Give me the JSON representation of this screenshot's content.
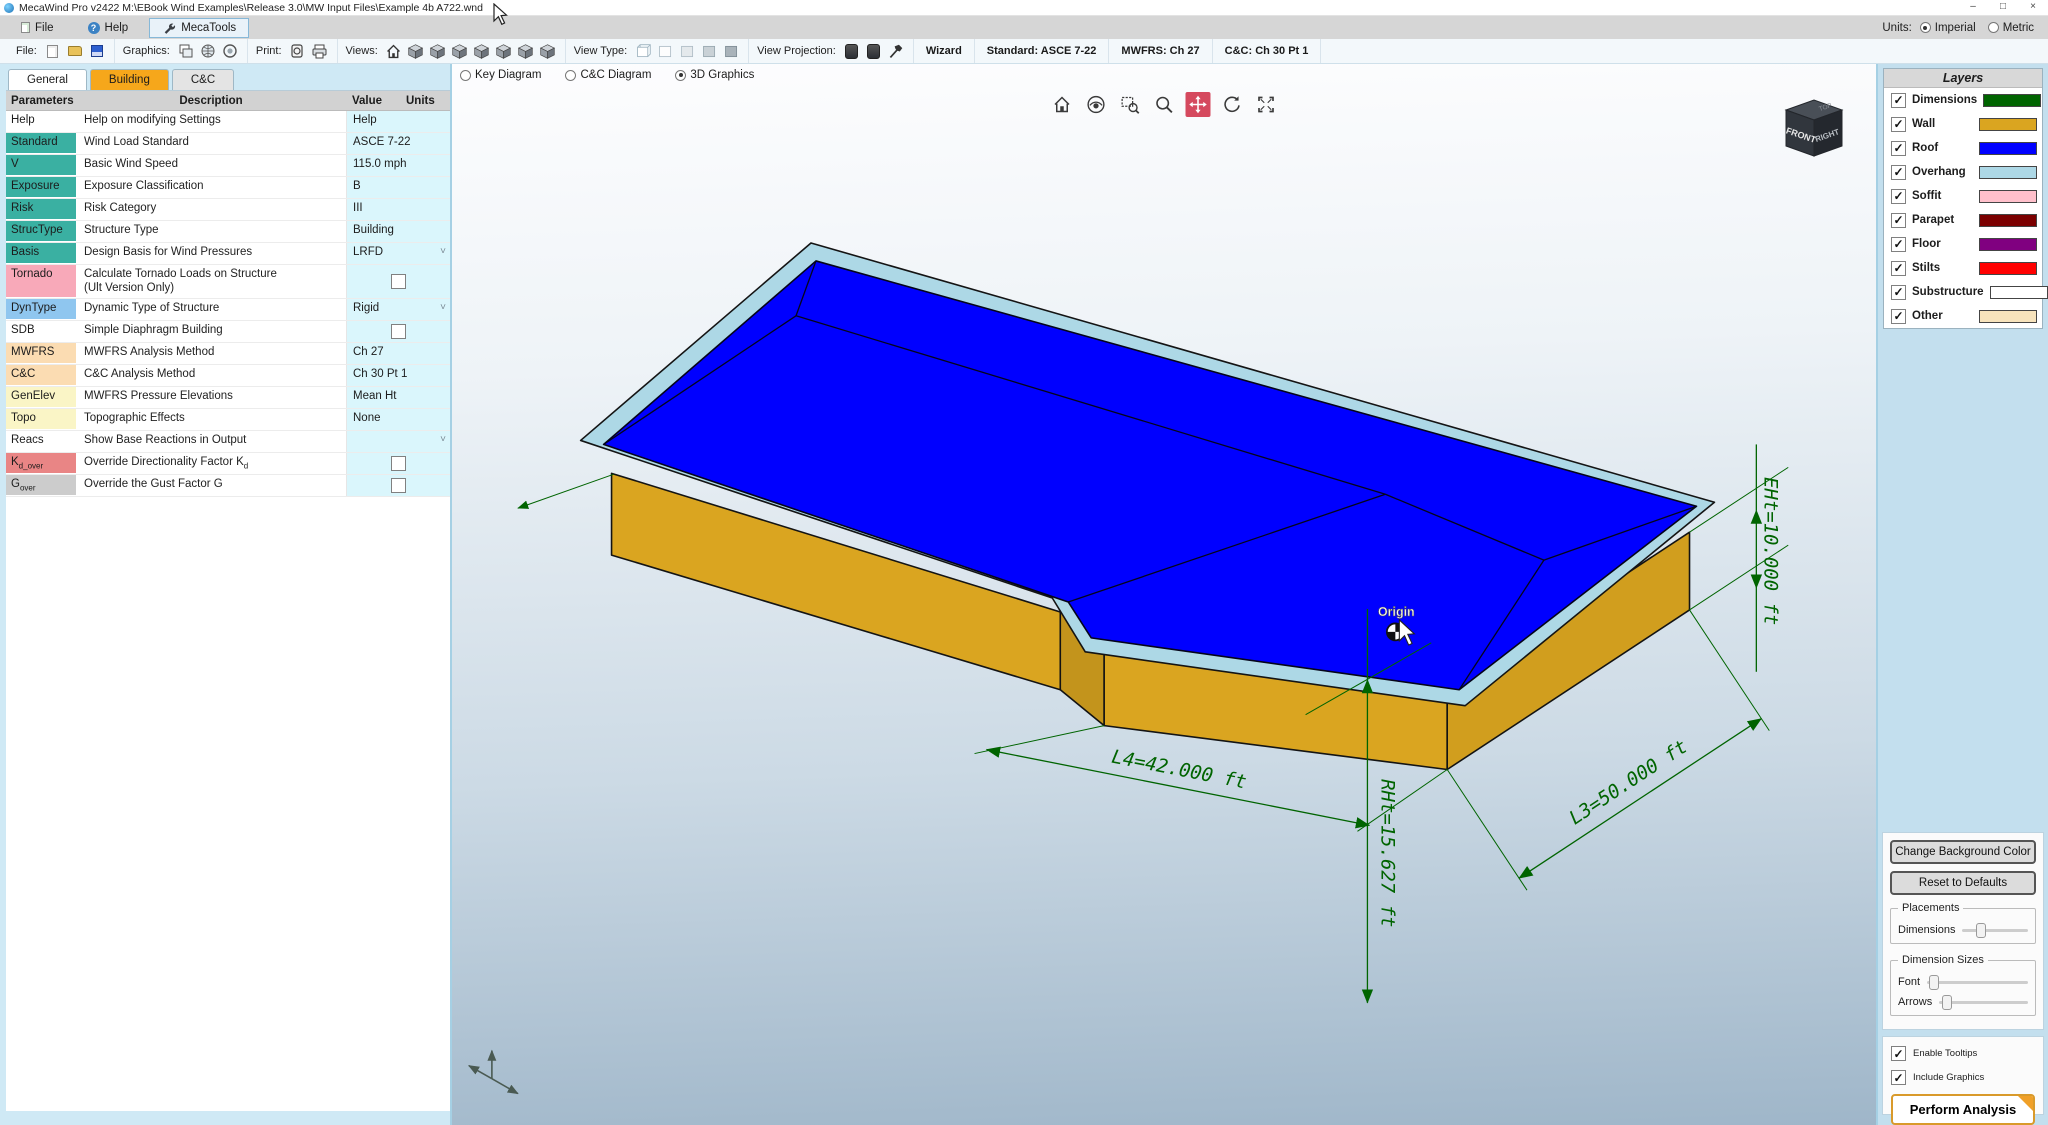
{
  "window": {
    "title": "MecaWind Pro v2422 M:\\EBook Wind Examples\\Release 3.0\\MW Input Files\\Example 4b A722.wnd",
    "controls": {
      "minimize": "–",
      "maximize": "□",
      "close": "×"
    }
  },
  "menu": {
    "items": [
      "File",
      "Help",
      "MecaTools"
    ],
    "units_label": "Units:",
    "units": [
      {
        "label": "Imperial",
        "selected": true
      },
      {
        "label": "Metric",
        "selected": false
      }
    ]
  },
  "toolbar": {
    "labels": {
      "file": "File:",
      "graphics": "Graphics:",
      "print": "Print:",
      "views": "Views:",
      "view_type": "View Type:",
      "view_projection": "View Projection:"
    },
    "buttons": [
      "Wizard",
      "Standard: ASCE 7-22",
      "MWFRS: Ch 27",
      "C&C: Ch 30 Pt 1"
    ]
  },
  "left_panel": {
    "tabs": [
      {
        "label": "General",
        "state": "active"
      },
      {
        "label": "Building",
        "state": "highlight"
      },
      {
        "label": "C&C",
        "state": "normal"
      }
    ],
    "table": {
      "headers": [
        "Parameters",
        "Description",
        "Value",
        "Units"
      ],
      "rows": [
        {
          "param": "Help",
          "color": "#ffffff",
          "description": "Help on modifying Settings",
          "value": "Help",
          "control": "text"
        },
        {
          "param": "Standard",
          "color": "#3ab0a2",
          "description": "Wind Load Standard",
          "value": "ASCE 7-22",
          "control": "text"
        },
        {
          "param": "V",
          "color": "#3ab0a2",
          "description": "Basic Wind Speed",
          "value": "115.0 mph",
          "control": "text"
        },
        {
          "param": "Exposure",
          "color": "#3ab0a2",
          "description": "Exposure Classification",
          "value": "B",
          "control": "text"
        },
        {
          "param": "Risk",
          "color": "#3ab0a2",
          "description": "Risk Category",
          "value": "III",
          "control": "text"
        },
        {
          "param": "StrucType",
          "color": "#3ab0a2",
          "description": "Structure Type",
          "value": "Building",
          "control": "text"
        },
        {
          "param": "Basis",
          "color": "#3ab0a2",
          "description": "Design Basis for Wind Pressures",
          "value": "LRFD",
          "control": "dropdown"
        },
        {
          "param": "Tornado",
          "color": "#f8a9b9",
          "description": "Calculate Tornado Loads on Structure\n(Ult Version Only)",
          "value": "",
          "control": "checkbox",
          "checked": false,
          "tall": true
        },
        {
          "param": "DynType",
          "color": "#8fc6ef",
          "description": "Dynamic Type of Structure",
          "value": "Rigid",
          "control": "dropdown"
        },
        {
          "param": "SDB",
          "color": "#ffffff",
          "description": "Simple Diaphragm Building",
          "value": "",
          "control": "checkbox",
          "checked": false
        },
        {
          "param": "MWFRS",
          "color": "#fbdcb2",
          "description": "MWFRS Analysis Method",
          "value": "Ch 27",
          "control": "text"
        },
        {
          "param": "C&C",
          "color": "#fbdcb2",
          "description": "C&C Analysis Method",
          "value": "Ch 30 Pt 1",
          "control": "text"
        },
        {
          "param": "GenElev",
          "color": "#faf5c6",
          "description": "MWFRS Pressure Elevations",
          "value": "Mean Ht",
          "control": "text"
        },
        {
          "param": "Topo",
          "color": "#faf5c6",
          "description": "Topographic Effects",
          "value": "None",
          "control": "text"
        },
        {
          "param": "Reacs",
          "color": "#ffffff",
          "description": "Show Base Reactions in Output",
          "value": "",
          "control": "dropdown"
        },
        {
          "param": "Kd_over",
          "param_main": "K",
          "param_sub": "d_over",
          "color": "#e98585",
          "desc_main": "Override Directionality Factor K",
          "desc_sub": "d",
          "description": "Override Directionality Factor Kd",
          "value": "",
          "control": "checkbox",
          "checked": false
        },
        {
          "param": "Gover",
          "param_main": "G",
          "param_sub": "over",
          "color": "#cccccc",
          "description": "Override the Gust Factor G",
          "value": "",
          "control": "checkbox",
          "checked": false
        }
      ]
    }
  },
  "viewport": {
    "modes": [
      {
        "label": "Key Diagram",
        "selected": false
      },
      {
        "label": "C&C Diagram",
        "selected": false
      },
      {
        "label": "3D Graphics",
        "selected": true
      }
    ],
    "active_tool": "pan",
    "nav_cube": {
      "front": "FRONT",
      "right": "RIGHT",
      "top": "TOP"
    },
    "dimensions": {
      "l4": "L4=42.000 ft",
      "l3": "L3=50.000 ft",
      "eht": "EHt=10.000 ft",
      "rht": "RHt=15.627 ft"
    },
    "origin_label": "Origin"
  },
  "layers_panel": {
    "title": "Layers",
    "items": [
      {
        "label": "Dimensions",
        "color": "#006400",
        "checked": true
      },
      {
        "label": "Wall",
        "color": "#DAA520",
        "checked": true
      },
      {
        "label": "Roof",
        "color": "#0000FF",
        "checked": true
      },
      {
        "label": "Overhang",
        "color": "#ADD8E6",
        "checked": true
      },
      {
        "label": "Soffit",
        "color": "#FFC0CB",
        "checked": true
      },
      {
        "label": "Parapet",
        "color": "#7B0000",
        "checked": true
      },
      {
        "label": "Floor",
        "color": "#800080",
        "checked": true
      },
      {
        "label": "Stilts",
        "color": "#FF0000",
        "checked": true
      },
      {
        "label": "Substructure",
        "color": "#FFFFFF",
        "checked": true
      },
      {
        "label": "Other",
        "color": "#F7E3BC",
        "checked": true
      }
    ]
  },
  "right_controls": {
    "change_bg": "Change Background Color",
    "reset": "Reset to Defaults",
    "placements": "Placements",
    "dimensions_label": "Dimensions",
    "dimension_sizes": "Dimension Sizes",
    "font_label": "Font",
    "arrows_label": "Arrows",
    "sliders": {
      "dimensions_pct": 28,
      "font_pct": 7,
      "arrows_pct": 9
    },
    "enable_tooltips": "Enable Tooltips",
    "include_graphics": "Include Graphics",
    "perform": "Perform Analysis"
  }
}
